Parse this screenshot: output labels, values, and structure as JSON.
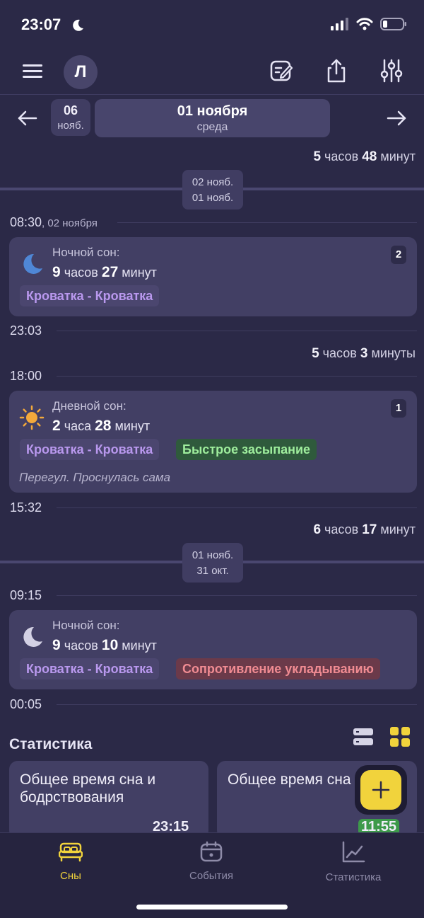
{
  "status_bar": {
    "time": "23:07"
  },
  "header": {
    "avatar_letter": "Л"
  },
  "date_nav": {
    "prev_day": "06",
    "prev_month": "нояб.",
    "current_date": "01 ноября",
    "current_weekday": "среда"
  },
  "timeline": {
    "gap1": {
      "hours": "5",
      "hours_unit": "часов",
      "minutes": "48",
      "minutes_unit": "минут"
    },
    "day_chip1": {
      "top": "02 нояб.",
      "bottom": "01 нояб."
    },
    "time1": "08:30",
    "time1_sub": ", 02 ноября",
    "card1": {
      "title": "Ночной сон:",
      "hours": "9",
      "hours_unit": "часов",
      "minutes": "27",
      "minutes_unit": "минут",
      "count": "2",
      "tags": [
        "Кроватка - Кроватка"
      ]
    },
    "time2": "23:03",
    "gap2": {
      "hours": "5",
      "hours_unit": "часов",
      "minutes": "3",
      "minutes_unit": "минуты"
    },
    "time3": "18:00",
    "card2": {
      "title": "Дневной сон:",
      "hours": "2",
      "hours_unit": "часа",
      "minutes": "28",
      "minutes_unit": "минут",
      "count": "1",
      "tags": [
        "Кроватка - Кроватка",
        "Быстрое засыпание"
      ],
      "note": "Перегул. Проснулась сама"
    },
    "time4": "15:32",
    "gap3": {
      "hours": "6",
      "hours_unit": "часов",
      "minutes": "17",
      "minutes_unit": "минут"
    },
    "day_chip2": {
      "top": "01 нояб.",
      "bottom": "31 окт."
    },
    "time5": "09:15",
    "card3": {
      "title": "Ночной сон:",
      "hours": "9",
      "hours_unit": "часов",
      "minutes": "10",
      "minutes_unit": "минут",
      "tags": [
        "Кроватка - Кроватка",
        "Сопротивление укладыванию"
      ]
    },
    "time6": "00:05"
  },
  "stats": {
    "title": "Статистика",
    "cards": [
      {
        "title": "Общее время сна и бодрствования",
        "value": "23:15"
      },
      {
        "title": "Общее время сна",
        "value": "11:55"
      }
    ]
  },
  "bottom_nav": {
    "items": [
      {
        "label": "Сны",
        "icon": "bed-icon"
      },
      {
        "label": "События",
        "icon": "calendar-icon"
      },
      {
        "label": "Статистика",
        "icon": "chart-icon"
      }
    ]
  },
  "colors": {
    "background": "#2b2947",
    "accent": "#f1d33c",
    "active_nav": "#f1d33c"
  }
}
